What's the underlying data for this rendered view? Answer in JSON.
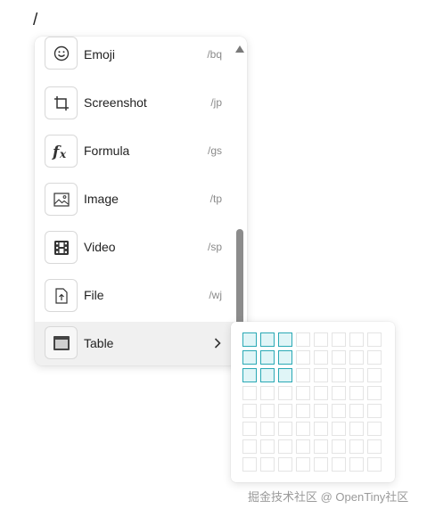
{
  "editor": {
    "trigger_char": "/"
  },
  "menu": {
    "items": [
      {
        "label": "Emoji",
        "shortcut": "/bq",
        "icon": "emoji-icon"
      },
      {
        "label": "Screenshot",
        "shortcut": "/jp",
        "icon": "crop-icon"
      },
      {
        "label": "Formula",
        "shortcut": "/gs",
        "icon": "formula-fx-icon"
      },
      {
        "label": "Image",
        "shortcut": "/tp",
        "icon": "image-icon"
      },
      {
        "label": "Video",
        "shortcut": "/sp",
        "icon": "video-film-icon"
      },
      {
        "label": "File",
        "shortcut": "/wj",
        "icon": "file-upload-icon"
      },
      {
        "label": "Table",
        "shortcut": "",
        "icon": "table-icon",
        "has_submenu": true
      }
    ],
    "active_item": "Table"
  },
  "table_picker": {
    "rows": 8,
    "cols": 8,
    "selected_rows": 3,
    "selected_cols": 3,
    "highlight_color": "#2aa9b5"
  },
  "watermark": {
    "text": "掘金技术社区 @ OpenTiny社区"
  }
}
